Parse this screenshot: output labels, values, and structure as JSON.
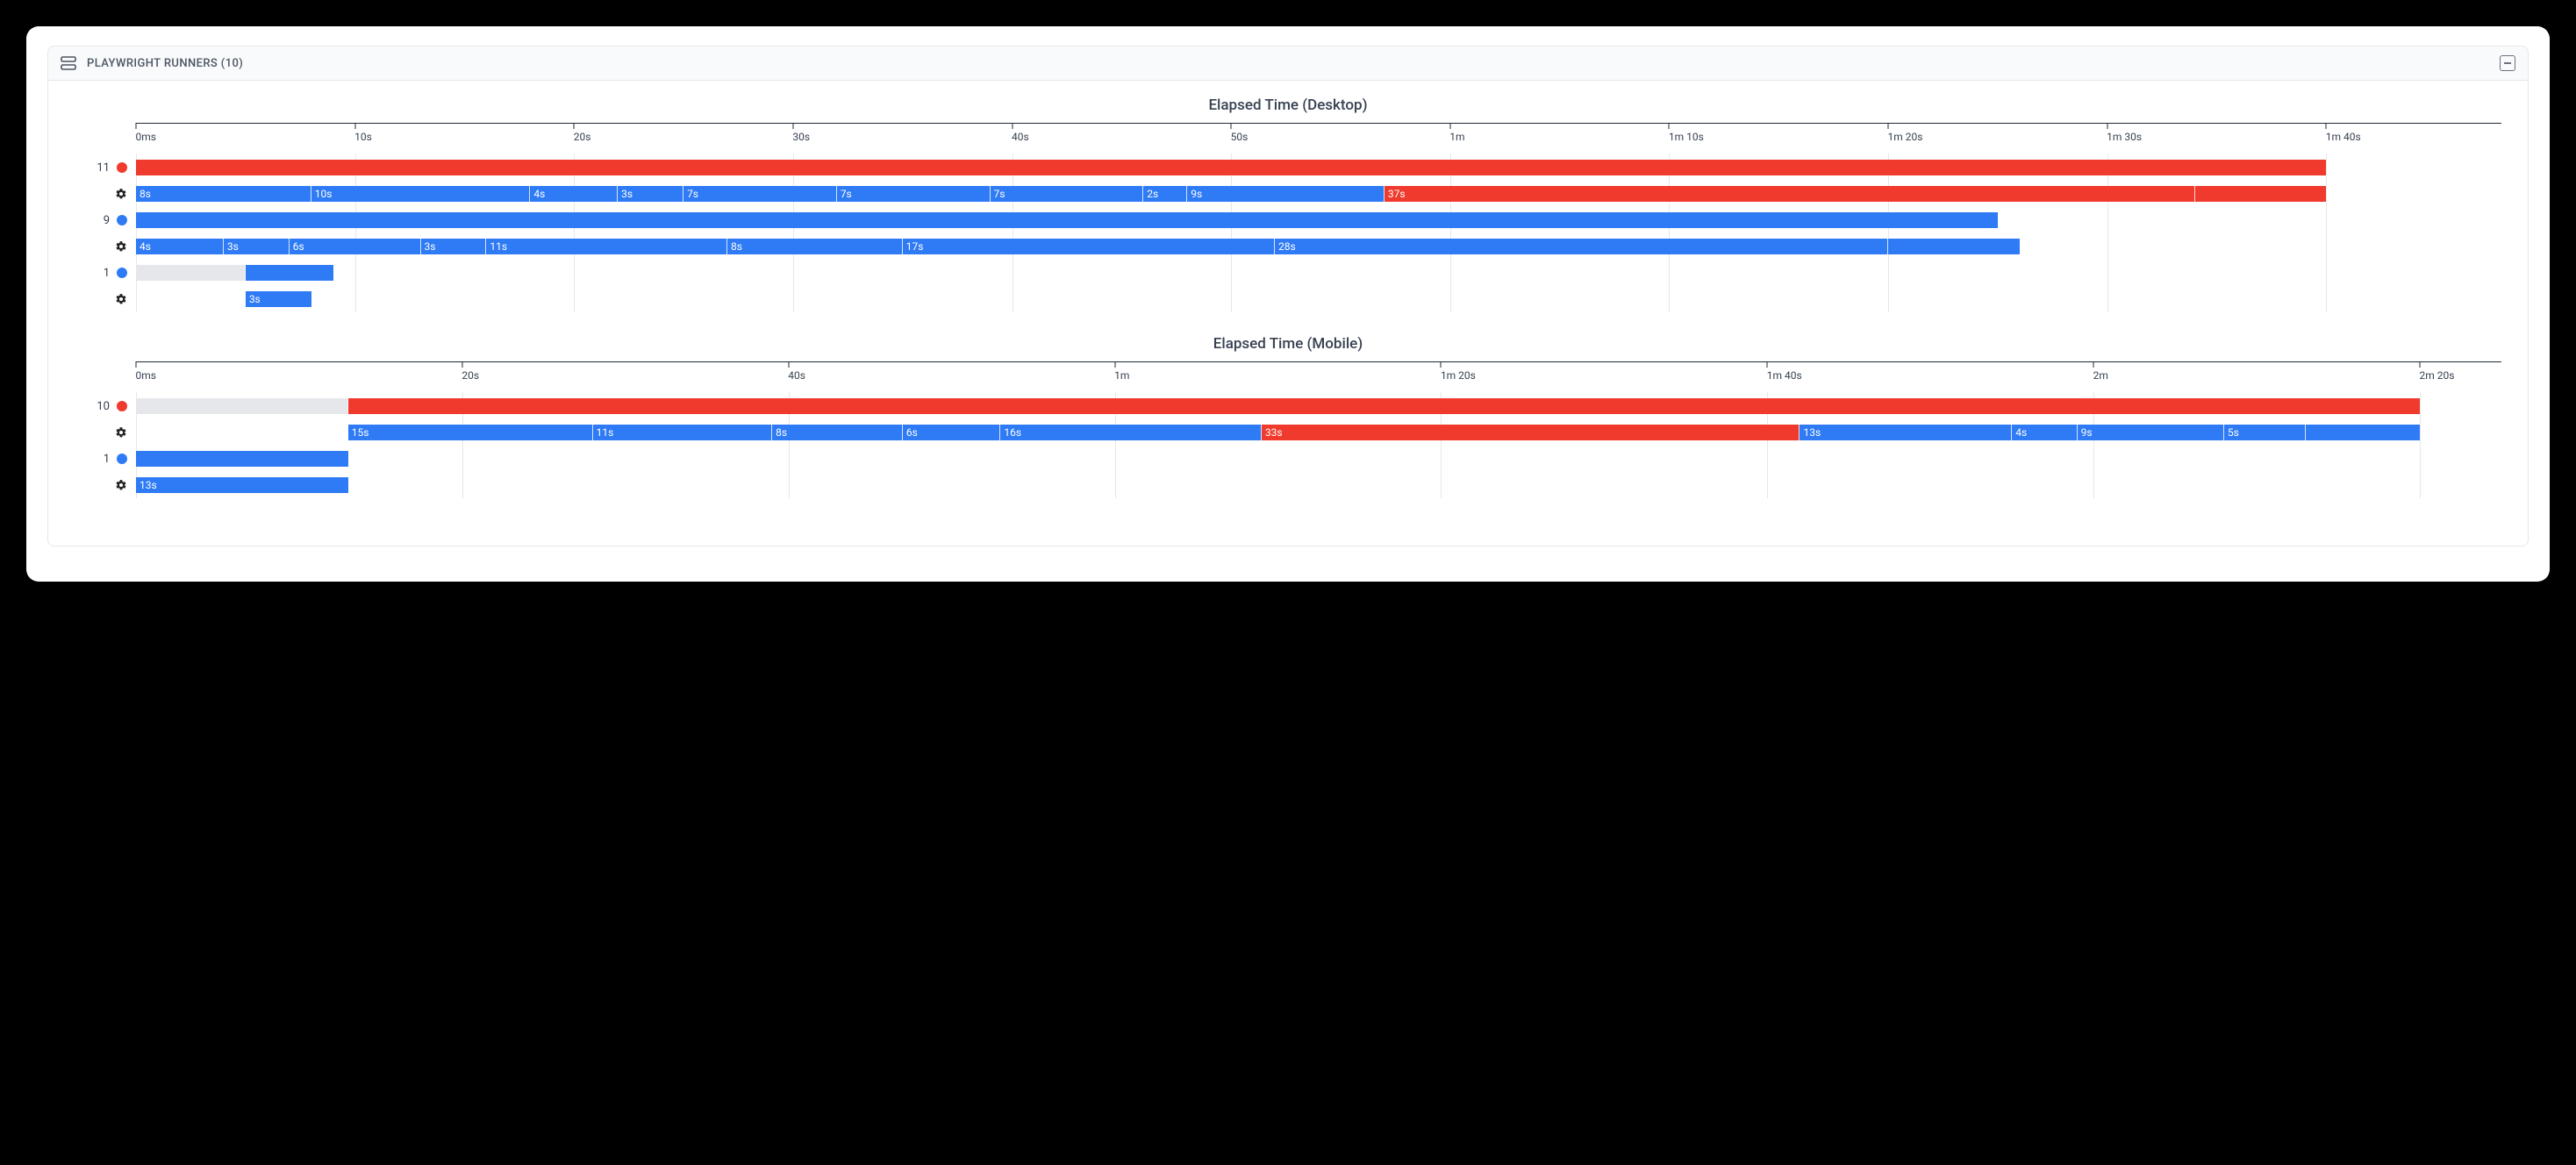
{
  "header": {
    "title": "PLAYWRIGHT RUNNERS (10)"
  },
  "colors": {
    "blue": "#2f7bf5",
    "red": "#ef3a2d",
    "grey": "#e5e7eb"
  },
  "chart_data": [
    {
      "type": "gantt",
      "title": "Elapsed Time (Desktop)",
      "x_max_seconds": 108,
      "ticks": [
        {
          "pos": 0,
          "label": "0ms"
        },
        {
          "pos": 10,
          "label": "10s"
        },
        {
          "pos": 20,
          "label": "20s"
        },
        {
          "pos": 30,
          "label": "30s"
        },
        {
          "pos": 40,
          "label": "40s"
        },
        {
          "pos": 50,
          "label": "50s"
        },
        {
          "pos": 60,
          "label": "1m"
        },
        {
          "pos": 70,
          "label": "1m 10s"
        },
        {
          "pos": 80,
          "label": "1m 20s"
        },
        {
          "pos": 90,
          "label": "1m 30s"
        },
        {
          "pos": 100,
          "label": "1m 40s"
        }
      ],
      "rows": [
        {
          "label": "11",
          "icon": "dot-red",
          "segments": [
            {
              "start": 0,
              "dur": 100,
              "color": "red",
              "text": "",
              "noborder": true
            }
          ]
        },
        {
          "label": "",
          "icon": "gear",
          "segments": [
            {
              "start": 0,
              "dur": 8,
              "color": "blue",
              "text": "8s"
            },
            {
              "start": 8,
              "dur": 10,
              "color": "blue",
              "text": "10s"
            },
            {
              "start": 18,
              "dur": 4,
              "color": "blue",
              "text": "4s"
            },
            {
              "start": 22,
              "dur": 3,
              "color": "blue",
              "text": "3s"
            },
            {
              "start": 25,
              "dur": 7,
              "color": "blue",
              "text": "7s"
            },
            {
              "start": 32,
              "dur": 7,
              "color": "blue",
              "text": "7s"
            },
            {
              "start": 39,
              "dur": 7,
              "color": "blue",
              "text": "7s"
            },
            {
              "start": 46,
              "dur": 2,
              "color": "blue",
              "text": "2s"
            },
            {
              "start": 48,
              "dur": 9,
              "color": "blue",
              "text": "9s"
            },
            {
              "start": 57,
              "dur": 37,
              "color": "red",
              "text": "37s"
            },
            {
              "start": 94,
              "dur": 6,
              "color": "red",
              "text": "",
              "noborder": true
            }
          ]
        },
        {
          "label": "9",
          "icon": "dot-blue",
          "segments": [
            {
              "start": 0,
              "dur": 85,
              "color": "blue",
              "text": "",
              "noborder": true
            }
          ]
        },
        {
          "label": "",
          "icon": "gear",
          "segments": [
            {
              "start": 0,
              "dur": 4,
              "color": "blue",
              "text": "4s"
            },
            {
              "start": 4,
              "dur": 3,
              "color": "blue",
              "text": "3s"
            },
            {
              "start": 7,
              "dur": 6,
              "color": "blue",
              "text": "6s"
            },
            {
              "start": 13,
              "dur": 3,
              "color": "blue",
              "text": "3s"
            },
            {
              "start": 16,
              "dur": 11,
              "color": "blue",
              "text": "11s"
            },
            {
              "start": 27,
              "dur": 8,
              "color": "blue",
              "text": "8s"
            },
            {
              "start": 35,
              "dur": 17,
              "color": "blue",
              "text": "17s"
            },
            {
              "start": 52,
              "dur": 28,
              "color": "blue",
              "text": "28s"
            },
            {
              "start": 80,
              "dur": 6,
              "color": "blue",
              "text": "",
              "noborder": true
            }
          ]
        },
        {
          "label": "1",
          "icon": "dot-blue",
          "segments": [
            {
              "start": 0,
              "dur": 5,
              "color": "grey",
              "text": ""
            },
            {
              "start": 5,
              "dur": 4,
              "color": "blue",
              "text": "",
              "noborder": true
            }
          ]
        },
        {
          "label": "",
          "icon": "gear",
          "segments": [
            {
              "start": 5,
              "dur": 3,
              "color": "blue",
              "text": "3s",
              "noborder": true
            }
          ]
        }
      ]
    },
    {
      "type": "gantt",
      "title": "Elapsed Time (Mobile)",
      "x_max_seconds": 145,
      "ticks": [
        {
          "pos": 0,
          "label": "0ms"
        },
        {
          "pos": 20,
          "label": "20s"
        },
        {
          "pos": 40,
          "label": "40s"
        },
        {
          "pos": 60,
          "label": "1m"
        },
        {
          "pos": 80,
          "label": "1m 20s"
        },
        {
          "pos": 100,
          "label": "1m 40s"
        },
        {
          "pos": 120,
          "label": "2m"
        },
        {
          "pos": 140,
          "label": "2m 20s"
        }
      ],
      "rows": [
        {
          "label": "10",
          "icon": "dot-red",
          "segments": [
            {
              "start": 0,
              "dur": 13,
              "color": "grey",
              "text": ""
            },
            {
              "start": 13,
              "dur": 127,
              "color": "red",
              "text": "",
              "noborder": true
            }
          ]
        },
        {
          "label": "",
          "icon": "gear",
          "segments": [
            {
              "start": 13,
              "dur": 15,
              "color": "blue",
              "text": "15s"
            },
            {
              "start": 28,
              "dur": 11,
              "color": "blue",
              "text": "11s"
            },
            {
              "start": 39,
              "dur": 8,
              "color": "blue",
              "text": "8s"
            },
            {
              "start": 47,
              "dur": 6,
              "color": "blue",
              "text": "6s"
            },
            {
              "start": 53,
              "dur": 16,
              "color": "blue",
              "text": "16s"
            },
            {
              "start": 69,
              "dur": 33,
              "color": "red",
              "text": "33s"
            },
            {
              "start": 102,
              "dur": 13,
              "color": "blue",
              "text": "13s"
            },
            {
              "start": 115,
              "dur": 4,
              "color": "blue",
              "text": "4s"
            },
            {
              "start": 119,
              "dur": 9,
              "color": "blue",
              "text": "9s"
            },
            {
              "start": 128,
              "dur": 5,
              "color": "blue",
              "text": "5s"
            },
            {
              "start": 133,
              "dur": 7,
              "color": "blue",
              "text": "",
              "noborder": true
            }
          ]
        },
        {
          "label": "1",
          "icon": "dot-blue",
          "segments": [
            {
              "start": 0,
              "dur": 13,
              "color": "blue",
              "text": "",
              "noborder": true
            }
          ]
        },
        {
          "label": "",
          "icon": "gear",
          "segments": [
            {
              "start": 0,
              "dur": 13,
              "color": "blue",
              "text": "13s",
              "noborder": true
            }
          ]
        }
      ]
    }
  ]
}
